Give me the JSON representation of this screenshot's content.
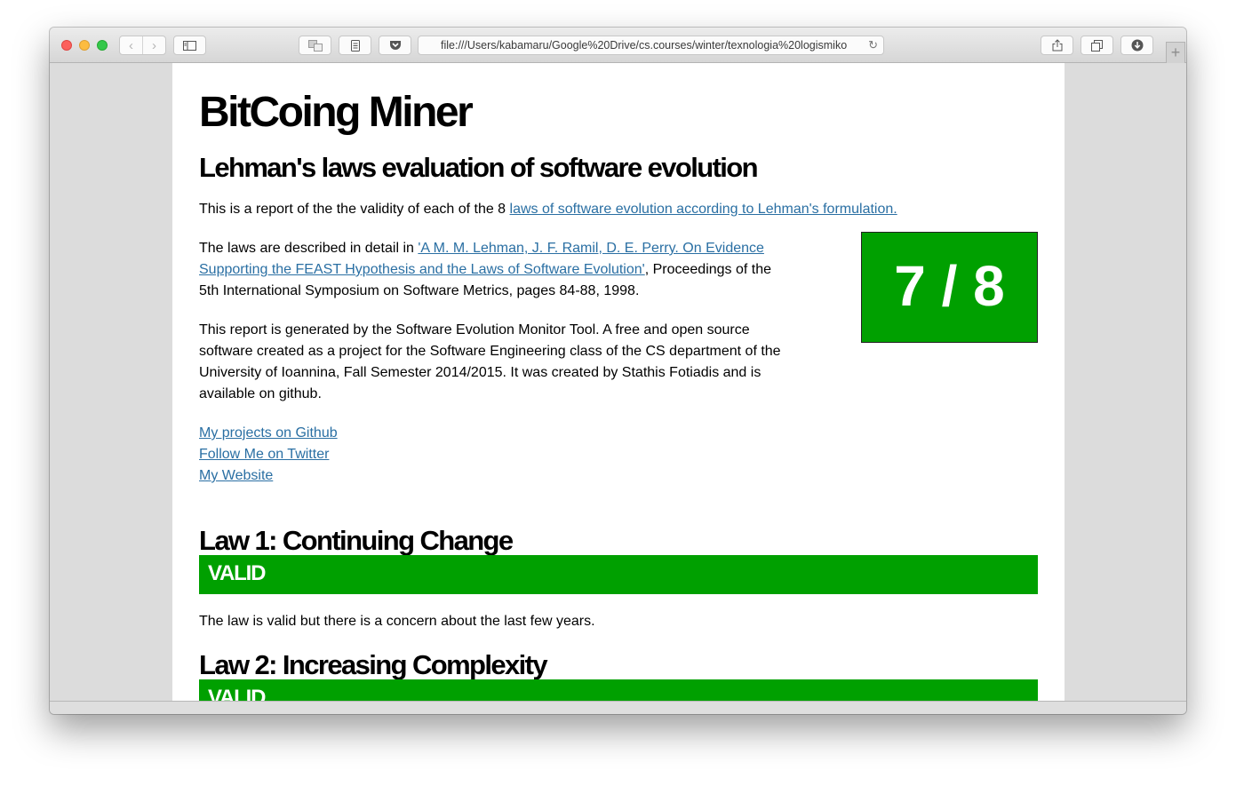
{
  "browser": {
    "url": "file:///Users/kabamaru/Google%20Drive/cs.courses/winter/texnologia%20logismiko",
    "nav_back": "‹",
    "nav_forward": "›",
    "new_tab": "+",
    "reload_icon": "↻"
  },
  "page": {
    "title": "BitCoing Miner",
    "subtitle": "Lehman's laws evaluation of software evolution",
    "intro_text": "This is a report of the the validity of each of the 8 ",
    "intro_link": "laws of software evolution according to Lehman's formulation.",
    "described_prefix": "The laws are described in detail in ",
    "described_link_line1": "'A M. M. Lehman, J. F. Ramil, D. E. Perry. On Evidence",
    "described_link_line2": "Supporting the FEAST Hypothesis and the Laws of Software Evolution'",
    "described_suffix_line2": ", Proceedings of the",
    "described_line3": "5th International Symposium on Software Metrics, pages 84-88, 1998.",
    "report_line1": "This report is generated by the Software Evolution Monitor Tool. A free and open source",
    "report_line2": "software created as a project for the Software Engineering class of the CS department of the",
    "report_line3": "University of Ioannina, Fall Semester 2014/2015. It was created by Stathis Fotiadis and is",
    "report_line4": "available on github.",
    "links": [
      "My projects on Github",
      "Follow Me on Twitter",
      "My Website"
    ],
    "score": "7 / 8",
    "laws": [
      {
        "title": "Law 1: Continuing Change",
        "status": "VALID",
        "note": "The law is valid but there is a concern about the last few years."
      },
      {
        "title": "Law 2: Increasing Complexity",
        "status": "VALID"
      }
    ]
  },
  "colors": {
    "valid_green": "#00a000",
    "link_blue": "#2a6fa3"
  }
}
